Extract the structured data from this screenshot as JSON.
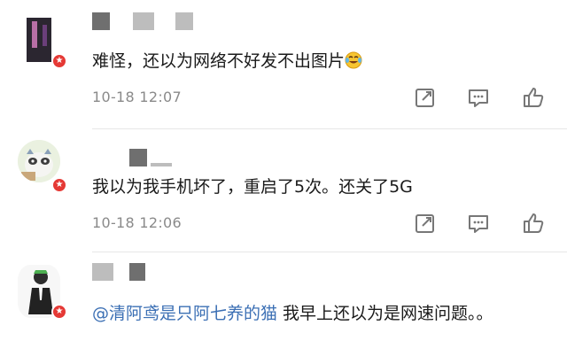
{
  "comments": [
    {
      "text": "难怪，还以为网络不好发不出图片",
      "emoji": "laughing-tears-emoji",
      "timestamp": "10-18 12:07"
    },
    {
      "text": "我以为我手机坏了，重启了5次。还关了5G",
      "timestamp": "10-18 12:06"
    },
    {
      "mention": "@清阿鸢是只阿七养的猫",
      "text": " 我早上还以为是网速问题。。"
    }
  ],
  "icons": {
    "share": "share-icon",
    "reply": "comment-icon",
    "like": "thumbs-up-icon",
    "badge": "verified-badge-icon"
  },
  "colors": {
    "mention": "#3b6fb4",
    "timestamp": "#8a8a8a",
    "badge": "#e53935"
  }
}
